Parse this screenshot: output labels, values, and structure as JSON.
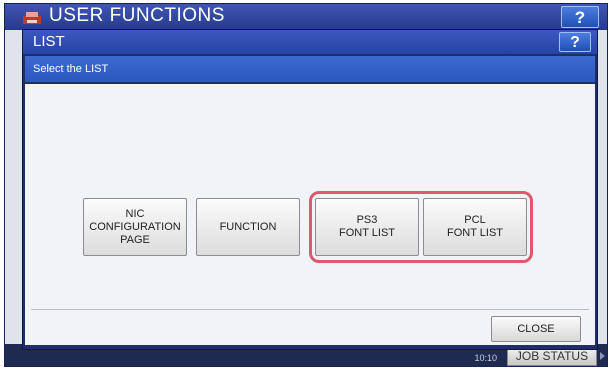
{
  "background_app": {
    "title": "USER FUNCTIONS",
    "help_label": "?",
    "time": "10:10",
    "job_status_label": "JOB STATUS"
  },
  "dialog": {
    "title": "LIST",
    "help_label": "?",
    "prompt": "Select the LIST",
    "buttons": [
      {
        "label": "NIC\nCONFIGURATION\nPAGE"
      },
      {
        "label": "FUNCTION"
      },
      {
        "label": "PS3\nFONT LIST"
      },
      {
        "label": "PCL\nFONT LIST"
      }
    ],
    "highlighted_buttons": [
      "PS3 FONT LIST",
      "PCL FONT LIST"
    ],
    "close_label": "CLOSE"
  },
  "colors": {
    "title_bar": "#2644a6",
    "prompt_bar": "#3060c8",
    "highlight": "#e0576f"
  }
}
